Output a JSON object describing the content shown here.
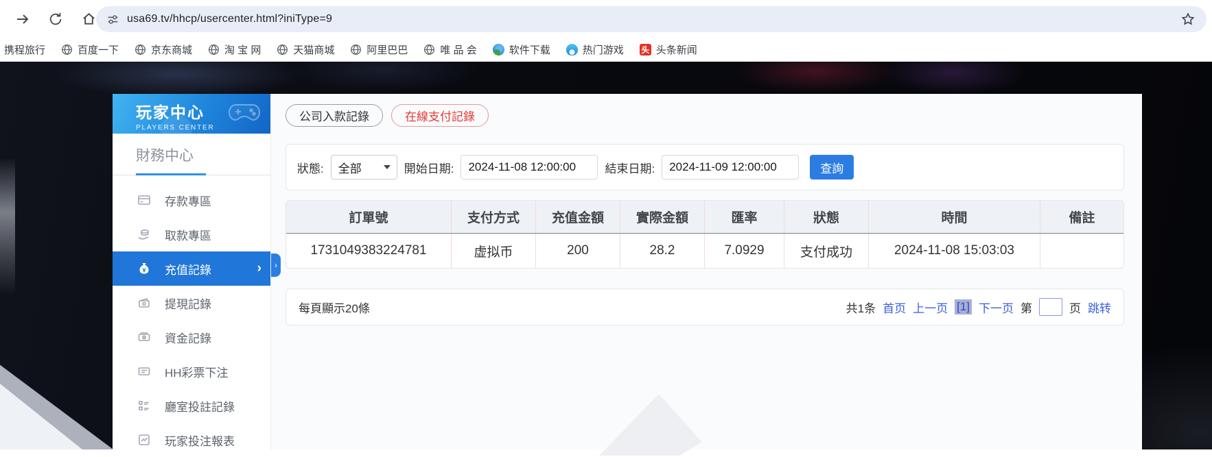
{
  "browser": {
    "url": "usa69.tv/hhcp/usercenter.html?iniType=9",
    "bookmarks": [
      "携程旅行",
      "百度一下",
      "京东商城",
      "淘 宝 网",
      "天猫商城",
      "阿里巴巴",
      "唯 品 会",
      "软件下载",
      "热门游戏",
      "头条新闻"
    ],
    "toutiao_glyph": "头"
  },
  "sidebar": {
    "title": "玩家中心",
    "subtitle": "PLAYERS CENTER",
    "section": "財務中心",
    "chevron": "›",
    "items": [
      {
        "label": "存款專區",
        "icon": "deposit"
      },
      {
        "label": "取款專區",
        "icon": "withdraw"
      },
      {
        "label": "充值記錄",
        "icon": "recharge",
        "active": true
      },
      {
        "label": "提現記錄",
        "icon": "cash-out"
      },
      {
        "label": "資金記錄",
        "icon": "funds"
      },
      {
        "label": "HH彩票下注",
        "icon": "lottery"
      },
      {
        "label": "廳室投註記錄",
        "icon": "hall-bets"
      },
      {
        "label": "玩家投注報表",
        "icon": "report"
      }
    ]
  },
  "tabs": [
    {
      "label": "公司入款記錄",
      "active": false
    },
    {
      "label": "在線支付記錄",
      "active": true
    }
  ],
  "filters": {
    "status_label": "狀態:",
    "status_value": "全部",
    "start_label": "開始日期:",
    "start_value": "2024-11-08 12:00:00",
    "end_label": "結束日期:",
    "end_value": "2024-11-09 12:00:00",
    "search_label": "查詢"
  },
  "table": {
    "headers": [
      "訂單號",
      "支付方式",
      "充值金額",
      "實際金額",
      "匯率",
      "狀態",
      "時間",
      "備註"
    ],
    "rows": [
      [
        "1731049383224781",
        "虚拟币",
        "200",
        "28.2",
        "7.0929",
        "支付成功",
        "2024-11-08 15:03:03",
        ""
      ]
    ]
  },
  "pagination": {
    "page_size_text": "每頁顯示20條",
    "total_text": "共1条",
    "first": "首页",
    "prev": "上一页",
    "current": "[1]",
    "next": "下一页",
    "jump_prefix": "第",
    "jump_suffix": "页",
    "jump_button": "跳转",
    "jump_value": ""
  },
  "colors": {
    "accent_blue": "#2176d9",
    "button_blue": "#2b7de3",
    "active_tab_red": "#e53935",
    "link_blue": "#3b5ede"
  },
  "handle_glyph": "›"
}
